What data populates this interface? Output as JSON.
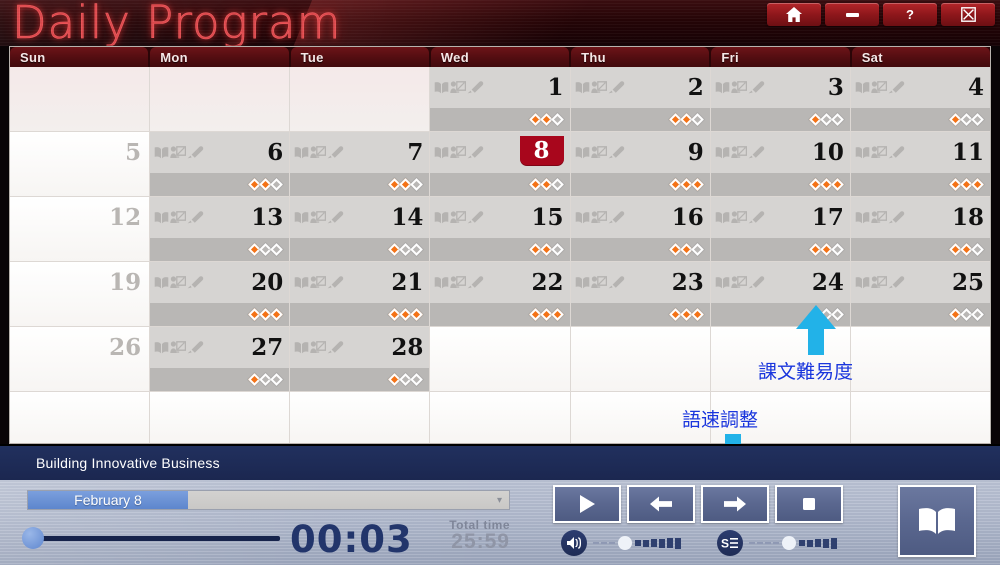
{
  "window": {
    "title": "Daily Program",
    "buttons": [
      {
        "name": "home-button",
        "icon": "home-icon",
        "label": ""
      },
      {
        "name": "minimize-button",
        "icon": "minimize-icon",
        "label": ""
      },
      {
        "name": "help-button",
        "icon": "help-icon",
        "label": "?"
      },
      {
        "name": "close-button",
        "icon": "close-icon",
        "label": ""
      }
    ]
  },
  "calendar": {
    "day_headers": [
      "Sun",
      "Mon",
      "Tue",
      "Wed",
      "Thu",
      "Fri",
      "Sat"
    ],
    "selected_day": 8,
    "icons": [
      "book-icon",
      "presentation-icon",
      "pencil-icon"
    ],
    "weeks": [
      [
        {
          "day": "",
          "state": "empty",
          "difficulty": 0
        },
        {
          "day": "",
          "state": "empty",
          "difficulty": 0
        },
        {
          "day": "",
          "state": "empty",
          "difficulty": 0
        },
        {
          "day": "1",
          "state": "active",
          "difficulty": 2
        },
        {
          "day": "2",
          "state": "active",
          "difficulty": 2
        },
        {
          "day": "3",
          "state": "active",
          "difficulty": 1
        },
        {
          "day": "4",
          "state": "active",
          "difficulty": 1
        }
      ],
      [
        {
          "day": "5",
          "state": "inactive",
          "difficulty": 0
        },
        {
          "day": "6",
          "state": "active",
          "difficulty": 2
        },
        {
          "day": "7",
          "state": "active",
          "difficulty": 2
        },
        {
          "day": "8",
          "state": "selected",
          "difficulty": 2
        },
        {
          "day": "9",
          "state": "active",
          "difficulty": 3
        },
        {
          "day": "10",
          "state": "active",
          "difficulty": 3
        },
        {
          "day": "11",
          "state": "active",
          "difficulty": 3
        }
      ],
      [
        {
          "day": "12",
          "state": "inactive",
          "difficulty": 0
        },
        {
          "day": "13",
          "state": "active",
          "difficulty": 1
        },
        {
          "day": "14",
          "state": "active",
          "difficulty": 1
        },
        {
          "day": "15",
          "state": "active",
          "difficulty": 2
        },
        {
          "day": "16",
          "state": "active",
          "difficulty": 2
        },
        {
          "day": "17",
          "state": "active",
          "difficulty": 2
        },
        {
          "day": "18",
          "state": "active",
          "difficulty": 2
        }
      ],
      [
        {
          "day": "19",
          "state": "inactive",
          "difficulty": 0
        },
        {
          "day": "20",
          "state": "active",
          "difficulty": 3
        },
        {
          "day": "21",
          "state": "active",
          "difficulty": 3
        },
        {
          "day": "22",
          "state": "active",
          "difficulty": 3
        },
        {
          "day": "23",
          "state": "active",
          "difficulty": 3
        },
        {
          "day": "24",
          "state": "active",
          "difficulty": 1
        },
        {
          "day": "25",
          "state": "active",
          "difficulty": 1
        }
      ],
      [
        {
          "day": "26",
          "state": "inactive",
          "difficulty": 0
        },
        {
          "day": "27",
          "state": "active",
          "difficulty": 1
        },
        {
          "day": "28",
          "state": "active",
          "difficulty": 1
        },
        {
          "day": "",
          "state": "empty",
          "difficulty": 0
        },
        {
          "day": "",
          "state": "empty",
          "difficulty": 0
        },
        {
          "day": "",
          "state": "empty",
          "difficulty": 0
        },
        {
          "day": "",
          "state": "empty",
          "difficulty": 0
        }
      ],
      [
        {
          "day": "",
          "state": "empty",
          "difficulty": 0
        },
        {
          "day": "",
          "state": "empty",
          "difficulty": 0
        },
        {
          "day": "",
          "state": "empty",
          "difficulty": 0
        },
        {
          "day": "",
          "state": "empty",
          "difficulty": 0
        },
        {
          "day": "",
          "state": "empty",
          "difficulty": 0
        },
        {
          "day": "",
          "state": "empty",
          "difficulty": 0
        },
        {
          "day": "",
          "state": "empty",
          "difficulty": 0
        }
      ]
    ]
  },
  "annotations": [
    {
      "name": "difficulty-annotation",
      "text": "課文難易度",
      "direction": "up"
    },
    {
      "name": "speed-annotation",
      "text": "語速調整",
      "direction": "down"
    }
  ],
  "player": {
    "lesson_title": "Building Innovative Business",
    "lesson_select_value": "February 8",
    "lesson_select_placeholder": "February 8",
    "current_time": "00:03",
    "total_time_label": "Total time",
    "total_time_value": "25:59",
    "controls": [
      {
        "name": "play-button",
        "icon": "play-icon"
      },
      {
        "name": "previous-button",
        "icon": "arrow-left-icon"
      },
      {
        "name": "next-button",
        "icon": "arrow-right-icon"
      },
      {
        "name": "stop-button",
        "icon": "stop-icon"
      }
    ],
    "book_button": {
      "name": "book-button",
      "icon": "book-icon"
    },
    "volume_slider": {
      "name": "volume-slider",
      "icon": "speaker-icon"
    },
    "speed_slider": {
      "name": "speed-slider",
      "icon": "speed-icon"
    }
  },
  "colors": {
    "accent_red": "#a8061c",
    "diamond_on": "#f47216",
    "annotation_blue": "#1a36dd",
    "arrow_cyan": "#22b2e8",
    "player_blue": "#21305e"
  }
}
